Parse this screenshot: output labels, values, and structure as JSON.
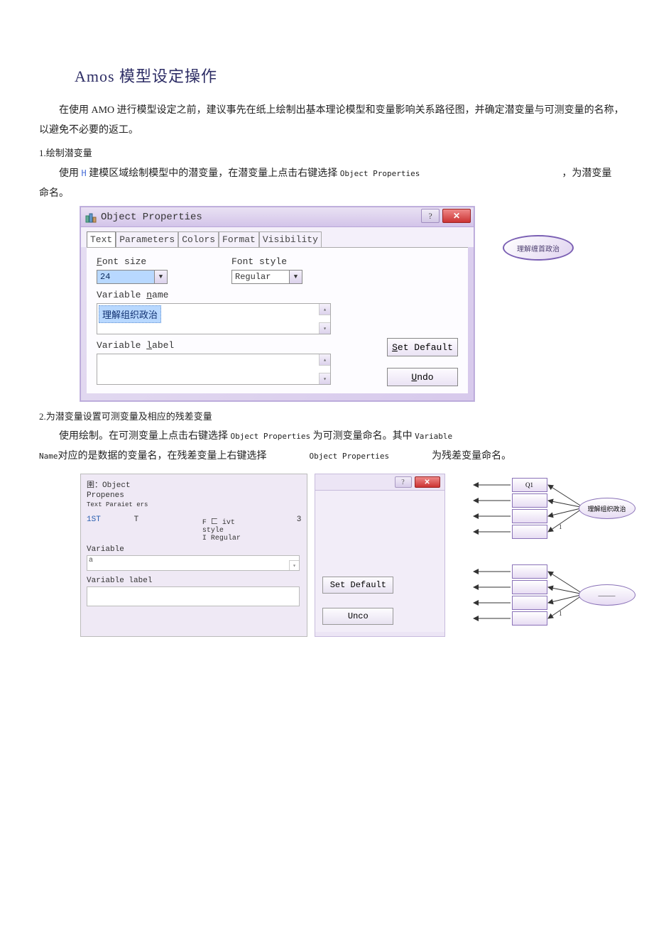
{
  "title": "Amos 模型设定操作",
  "intro": "在使用 AMO 进行模型设定之前，建议事先在纸上绘制出基本理论模型和变量影响关系路径图，并确定潜变量与可测变量的名称，以避免不必要的返工。",
  "sec1": {
    "num": "1.绘制潜变量",
    "pre": "使用 ",
    "h": "H",
    "mid": " 建模区域绘制模型中的潜变量，在潜变量上点击右键选择 ",
    "code": "Object Properties",
    "tail": "，为潜变量",
    "cont": "命名。"
  },
  "dlg": {
    "title": "Object Properties",
    "help": "?",
    "close": "✕",
    "tabs": [
      "Text",
      "Parameters",
      "Colors",
      "Format",
      "Visibility"
    ],
    "font_size_label": "Font size",
    "font_size_value": "24",
    "font_style_label": "Font style",
    "font_style_value": "Regular",
    "var_name_label": "Variable name",
    "var_name_value": "理解组织政治",
    "var_label_label": "Variable label",
    "set_default": "Set Default",
    "undo": "Undo"
  },
  "ellipse_text": "理解缠首政治",
  "sec2": {
    "num": "2.为潜变量设置可测变量及相应的残差变量",
    "line1_pre": "使用绘制。在可测变量上点击右键选择 ",
    "obj_prop": "Object Properties",
    "line1_mid": " 为可测变量命名。其中 ",
    "variable": "Variable",
    "line2_pre": "Name",
    "line2_txt": "对应的是数据的变量名，在残差变量上右键选择",
    "line2_code": "Object Properties",
    "line2_tail": "为残差变量命名。"
  },
  "dlg2": {
    "header1": "圉：Object",
    "header2": "Propenes",
    "header3": "Text Paraiet ers",
    "fontlabel": "F 匚 ivt",
    "fontlabel2": "style",
    "fontvalue": "I Regular",
    "num1": "1ST",
    "T": "T",
    "num3": "3",
    "var_label": "Variable",
    "var_value": "a",
    "var_label2": "Variable label"
  },
  "cc": {
    "help": "?",
    "close": "✕",
    "set_default": "Set Default",
    "undo": "Unco"
  },
  "model": {
    "q1": "Q1",
    "upper_label": "理解组织政治",
    "one": "1",
    "lower_label": "———"
  }
}
